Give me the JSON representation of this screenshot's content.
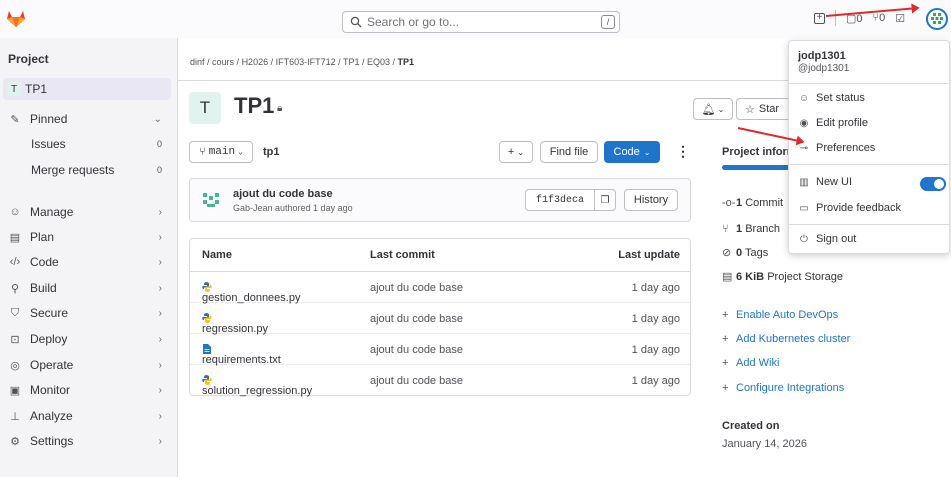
{
  "search": {
    "placeholder": "Search or go to...",
    "shortcut": "/"
  },
  "topbar": {
    "issues_count": "0",
    "mr_count": "0"
  },
  "sidebar": {
    "title": "Project",
    "project": {
      "avatar_letter": "T",
      "name": "TP1"
    },
    "pinned": "Pinned",
    "issues": {
      "label": "Issues",
      "count": "0"
    },
    "merge_requests": {
      "label": "Merge requests",
      "count": "0"
    },
    "items": [
      "Manage",
      "Plan",
      "Code",
      "Build",
      "Secure",
      "Deploy",
      "Operate",
      "Monitor",
      "Analyze",
      "Settings"
    ]
  },
  "breadcrumb": [
    "dinf",
    "cours",
    "H2026",
    "IFT603-IFT712",
    "TP1",
    "EQ03",
    "TP1"
  ],
  "project": {
    "avatar_letter": "T",
    "title": "TP1"
  },
  "buttons": {
    "star": "Star",
    "branch": "main",
    "path": "tp1",
    "add": "+",
    "find_file": "Find file",
    "code": "Code",
    "history": "History"
  },
  "commit": {
    "message": "ajout du code base",
    "author_line": "Gab-Jean authored 1 day ago",
    "sha": "f1f3deca"
  },
  "table": {
    "headers": {
      "name": "Name",
      "last_commit": "Last commit",
      "last_update": "Last update"
    },
    "rows": [
      {
        "name": "gestion_donnees.py",
        "commit": "ajout du code base",
        "updated": "1 day ago",
        "icon": "python-file-icon"
      },
      {
        "name": "regression.py",
        "commit": "ajout du code base",
        "updated": "1 day ago",
        "icon": "python-file-icon"
      },
      {
        "name": "requirements.txt",
        "commit": "ajout du code base",
        "updated": "1 day ago",
        "icon": "text-file-icon"
      },
      {
        "name": "solution_regression.py",
        "commit": "ajout du code base",
        "updated": "1 day ago",
        "icon": "python-file-icon"
      }
    ]
  },
  "project_info": {
    "heading": "Project inform",
    "commits": {
      "count": "1",
      "label": "Commit"
    },
    "branches": {
      "count": "1",
      "label": "Branch"
    },
    "tags": {
      "count": "0",
      "label": "Tags"
    },
    "storage": {
      "size": "6 KiB",
      "label": "Project Storage"
    },
    "actions": [
      "Enable Auto DevOps",
      "Add Kubernetes cluster",
      "Add Wiki",
      "Configure Integrations"
    ],
    "created_on_label": "Created on",
    "created_on": "January 14, 2026"
  },
  "user_menu": {
    "name": "jodp1301",
    "handle": "@jodp1301",
    "set_status": "Set status",
    "edit_profile": "Edit profile",
    "preferences": "Preferences",
    "new_ui": "New UI",
    "provide_feedback": "Provide feedback",
    "sign_out": "Sign out"
  },
  "colors": {
    "accent": "#1f75cb",
    "annotation_arrow": "#e0282d"
  }
}
